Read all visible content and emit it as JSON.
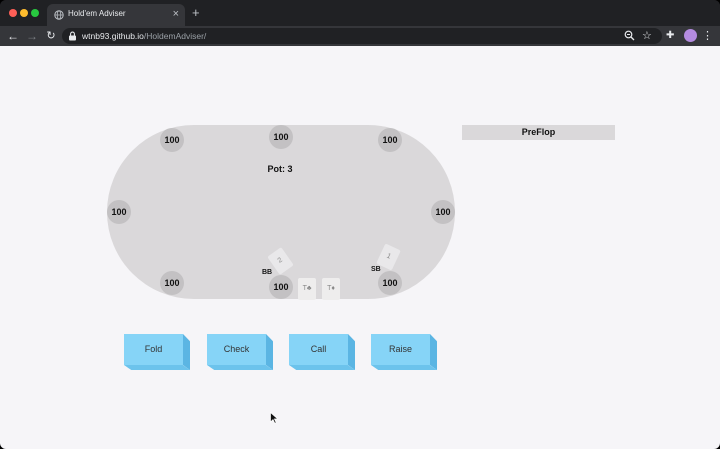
{
  "browser": {
    "tab_title": "Hold'em Adviser",
    "tab_close": "×",
    "new_tab": "+",
    "url_host": "wtnb93.github.io",
    "url_path": "/HoldemAdviser/",
    "icons": [
      "back-icon",
      "forward-icon",
      "reload-icon",
      "lock-icon",
      "zoom-icon",
      "star-icon",
      "extensions-icon",
      "avatar",
      "menu-icon"
    ]
  },
  "table": {
    "pot_label": "Pot: 3",
    "seats": {
      "top_left": "100",
      "top_center": "100",
      "top_right": "100",
      "mid_left": "100",
      "mid_right": "100",
      "bottom_left": "100",
      "bottom_center": "100",
      "bottom_right": "100"
    },
    "bb_label": "BB",
    "sb_label": "SB",
    "bb_bet_card": "2",
    "sb_bet_card": "1",
    "hole_cards": [
      "T♣",
      "T♦"
    ]
  },
  "stage": "PreFlop",
  "actions": {
    "fold": "Fold",
    "check": "Check",
    "call": "Call",
    "raise": "Raise"
  },
  "colors": {
    "page_bg": "#f6f5f8",
    "table": "#dad8da",
    "seat": "#c3c1c3",
    "button": "#86d4f7"
  }
}
